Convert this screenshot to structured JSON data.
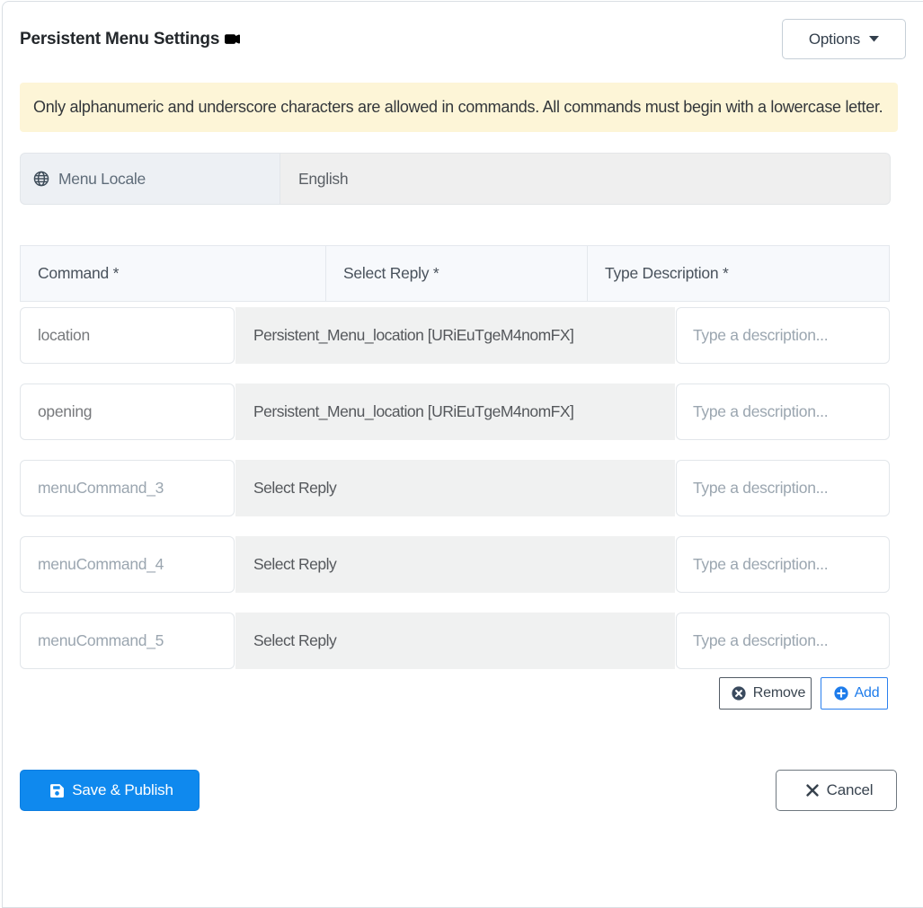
{
  "panel": {
    "title": "Persistent Menu Settings",
    "title_icon": "camera-video-icon",
    "options_button": {
      "label": "Options",
      "icon": "caret-down-icon"
    }
  },
  "alert": {
    "text": "Only alphanumeric and underscore characters are allowed in commands. All commands must begin with a lowercase letter."
  },
  "locale": {
    "icon": "globe-icon",
    "label": "Menu Locale",
    "value": "English"
  },
  "table": {
    "headers": {
      "command": "Command *",
      "reply": "Select Reply *",
      "description": "Type Description *"
    },
    "rows": [
      {
        "command_value": "location",
        "command_placeholder": "",
        "reply_value": "Persistent_Menu_location [URiEuTgeM4nomFX]",
        "description_value": "",
        "description_placeholder": "Type a description..."
      },
      {
        "command_value": "opening",
        "command_placeholder": "",
        "reply_value": "Persistent_Menu_location [URiEuTgeM4nomFX]",
        "description_value": "",
        "description_placeholder": "Type a description..."
      },
      {
        "command_value": "",
        "command_placeholder": "menuCommand_3",
        "reply_value": "Select Reply",
        "description_value": "",
        "description_placeholder": "Type a description..."
      },
      {
        "command_value": "",
        "command_placeholder": "menuCommand_4",
        "reply_value": "Select Reply",
        "description_value": "",
        "description_placeholder": "Type a description..."
      },
      {
        "command_value": "",
        "command_placeholder": "menuCommand_5",
        "reply_value": "Select Reply",
        "description_value": "",
        "description_placeholder": "Type a description..."
      }
    ],
    "actions": {
      "remove_label": "Remove",
      "remove_icon": "x-circle-icon",
      "add_label": "Add",
      "add_icon": "plus-circle-icon"
    }
  },
  "footer": {
    "save_label": "Save & Publish",
    "save_icon": "save-icon",
    "cancel_label": "Cancel",
    "cancel_icon": "x-icon"
  },
  "colors": {
    "primary_blue": "#0f89ee",
    "alert_bg": "#fdf5d7",
    "header_bg": "#f7f9fc",
    "select_bg": "#f0f1f1",
    "addon_bg": "#edf0f4"
  }
}
